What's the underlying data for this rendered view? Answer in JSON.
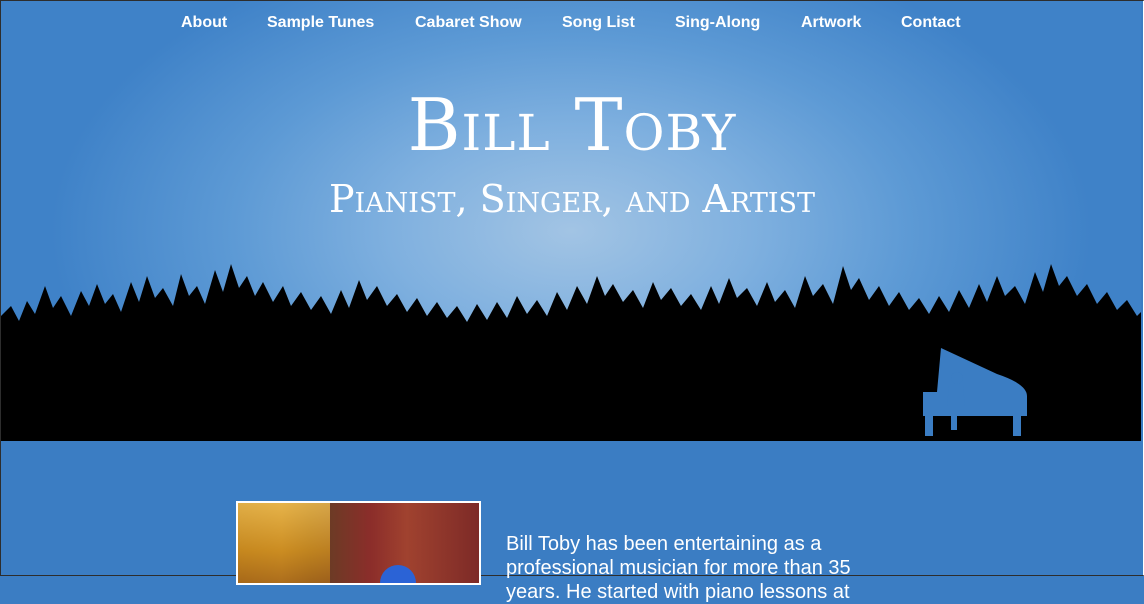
{
  "nav": {
    "items": [
      "About",
      "Sample Tunes",
      "Cabaret Show",
      "Song List",
      "Sing-Along",
      "Artwork",
      "Contact"
    ]
  },
  "header": {
    "title": "Bill Toby",
    "subtitle": "Pianist, Singer, and Artist"
  },
  "main": {
    "bio_text": "Bill Toby has been entertaining as a professional musician for more than 35 years. He started with piano lessons at"
  },
  "colors": {
    "background": "#3b7dc3",
    "sky_center": "#a2c4e4",
    "silhouette": "#000000",
    "text": "#ffffff"
  },
  "icons": {
    "piano_player": "piano-silhouette-icon"
  }
}
